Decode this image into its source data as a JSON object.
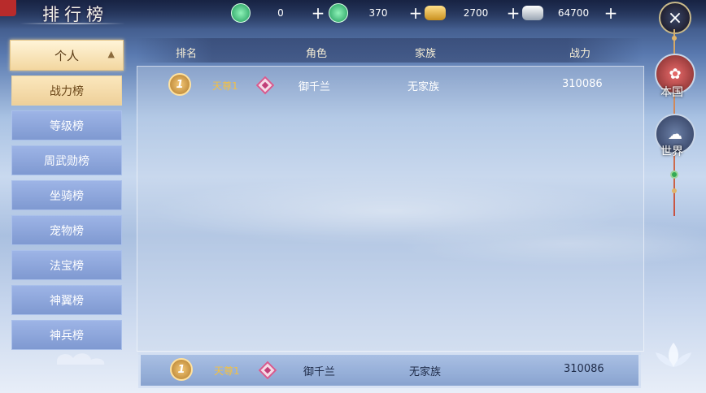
{
  "title": "排行榜",
  "currencies": [
    {
      "icon": "green-jade-icon",
      "value": "0",
      "color": "#2bb673"
    },
    {
      "icon": "locked-jade-icon",
      "value": "370",
      "color": "#27a765"
    },
    {
      "icon": "gold-ingot-icon",
      "value": "2700",
      "color": "#e6b63b"
    },
    {
      "icon": "silver-ingot-icon",
      "value": "64700",
      "color": "#c8d2dd"
    }
  ],
  "close_icon": "×",
  "menu": {
    "header": "个人",
    "items": [
      "战力榜",
      "等级榜",
      "周武勋榜",
      "坐骑榜",
      "宠物榜",
      "法宝榜",
      "神翼榜",
      "神兵榜"
    ],
    "active_index": 0
  },
  "table": {
    "columns": [
      "排名",
      "角色",
      "家族",
      "战力"
    ],
    "rows": [
      {
        "rank": "1",
        "title": "天尊1",
        "name": "御千兰",
        "family": "无家族",
        "power": "310086"
      }
    ]
  },
  "self_row": {
    "rank": "1",
    "title": "天尊1",
    "name": "御千兰",
    "family": "无家族",
    "power": "310086"
  },
  "side": {
    "local_label": "本国",
    "world_label": "世界"
  },
  "colors": {
    "accent_gold": "#f3c042",
    "active_tab": "#eed09a",
    "tab_blue": "#7f99d1"
  }
}
